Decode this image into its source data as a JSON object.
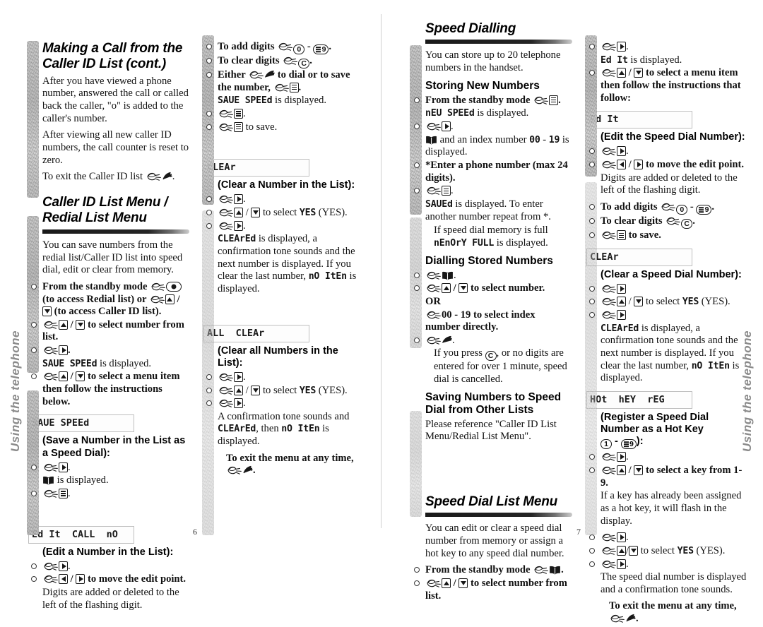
{
  "document": {
    "side_tab_label": "Using the telephone",
    "page_left_number": "6",
    "page_right_number": "7"
  },
  "page6": {
    "col1": {
      "heading": "Making a Call from the Caller ID List (cont.)",
      "para1": "After you have viewed a phone number, answered the call or called back the caller, \"o\" is added to the caller's number.",
      "para2": "After viewing all new caller ID numbers, the call counter is reset to zero.",
      "para3_pre": "To exit the Caller ID list ",
      "para3_post": ".",
      "section_heading": "Caller ID List Menu / Redial List Menu",
      "intro": "You can save numbers from the redial list/Caller ID list into speed dial, edit or clear from memory.",
      "step1_a": "From the standby mode ",
      "step1_b": " (to access Redial list) or ",
      "step1_c": " / ",
      "step1_d": " (to access Caller ID list).",
      "step2_a": "",
      "step2_b": " / ",
      "step2_c": " to select number from list.",
      "step3": ".",
      "line_saved_lcd": "SAUE SPEEd",
      "line_saved_post": " is displayed.",
      "step4_a": "",
      "step4_b": " / ",
      "step4_c": " to select a menu item then follow the instructions below.",
      "lcd_save_speed": "SAUE SPEEd",
      "sub_save": "(Save a Number in the List as a Speed Dial):",
      "save_step1": ".",
      "save_step2_post": " is displayed.",
      "save_step3": ".",
      "lcd_edit_call_no": "Ed It  CALL  nO",
      "sub_edit": "(Edit a Number in the List):",
      "edit_step1": ".",
      "edit_step2_mid": " / ",
      "edit_step2_post": " to  move the edit point.",
      "edit_note": "Digits are added or deleted to the left of the flashing digit."
    },
    "col2": {
      "add_digits_pre": "To add digits ",
      "add_digits_mid": " - ",
      "add_digits_post": ".",
      "clear_digits_pre": "To clear digits ",
      "clear_digits_post": ".",
      "either_pre": "Either ",
      "either_mid": " to dial or to save the number, ",
      "either_post": ".",
      "lcd_save_speed_inline": "SAUE SPEEd",
      "save_speed_post": " is displayed.",
      "step_menu": ".",
      "step_save_post": " to save.",
      "lcd_clear": "CLEAr",
      "sub_clear": "(Clear a Number in the List):",
      "clear_step1": ".",
      "clear_step2_mid": " / ",
      "clear_step2_post_a": " to select ",
      "clear_step2_yes": "YES",
      "clear_step2_post_b": " (YES).",
      "clear_step3": ".",
      "clear_result_lcd": "CLEArEd",
      "clear_result_a": " is displayed, a confirmation tone sounds and the next number is displayed. If you clear the last number, ",
      "clear_result_lcd2": "nO  ItEn",
      "clear_result_b": " is displayed.",
      "lcd_all_clear": "ALL  CLEAr",
      "sub_all_clear": "(Clear all Numbers in the List):",
      "allclear_result_a": "A confirmation tone sounds and ",
      "allclear_lcd1": "CLEArEd",
      "allclear_result_b": ", then ",
      "allclear_lcd2": "nO  ItEn",
      "allclear_result_c": " is displayed.",
      "exit_text": "To exit the menu at any time,",
      "exit_post": "."
    }
  },
  "page7": {
    "col1": {
      "section_heading": "Speed Dialling",
      "intro": "You can store up to 20 telephone numbers in the handset.",
      "sub_storing": "Storing New Numbers",
      "store_step1_pre": "From the standby mode ",
      "store_step1_post": ".",
      "lcd_new_speed": "nEU SPEEd",
      "new_speed_post": " is displayed.",
      "store_step2": ".",
      "store_step3_a": " and an index number ",
      "store_step3_lcd1": "00",
      "store_step3_b": " - ",
      "store_step3_lcd2": "19",
      "store_step3_c": " is displayed.",
      "store_step4": "*Enter a phone number (max 24 digits).",
      "store_step5": ".",
      "saved_lcd": "SAUEd",
      "saved_post": " is displayed. To enter another number repeat from *.",
      "memfull_a": "If speed dial memory is full ",
      "memfull_lcd": "nEnOrY FULL",
      "memfull_b": " is displayed.",
      "sub_dialling": "Dialling Stored Numbers",
      "dial_step1": ".",
      "dial_step2_mid": " / ",
      "dial_step2_post": " to select number.",
      "dial_or": "OR",
      "dial_step3": "00 - 19 to select index number directly.",
      "dial_step4": ".",
      "dial_note_a": "If you press ",
      "dial_note_b": ", or no digits are entered for over 1 minute, speed dial is cancelled.",
      "sub_saving_other": "Saving Numbers to Speed Dial from Other Lists",
      "saving_other_text": "Please reference \"Caller ID List Menu/Redial List Menu\".",
      "section_heading2": "Speed Dial List Menu",
      "intro2": "You can edit or clear a speed dial number from memory or assign a hot key to any speed dial number.",
      "sdl_step1_pre": "From the standby mode ",
      "sdl_step1_post": ".",
      "sdl_step2_mid": " / ",
      "sdl_step2_post": " to select number from list."
    },
    "col2": {
      "step1": ".",
      "edit_lcd_inline": "Ed It",
      "edit_inline_post": " is displayed.",
      "step2_mid": " / ",
      "step2_post": " to select a menu item then follow the instructions that follow:",
      "lcd_edit": "Ed It",
      "sub_edit": "(Edit the Speed Dial Number):",
      "edit_step1": ".",
      "edit_step2_mid": " / ",
      "edit_step2_post": " to move the edit point.",
      "edit_note": "Digits are added or deleted to the left of the flashing digit.",
      "add_digits_pre": "To add digits ",
      "add_digits_mid": " - ",
      "add_digits_post": ".",
      "clear_digits_pre": "To clear digits ",
      "clear_digits_post": ".",
      "save_post": " to save.",
      "lcd_clear": "CLEAr",
      "sub_clear": "(Clear a Speed Dial Number):",
      "clear_step1": "",
      "clear_step2_mid": " / ",
      "clear_step2_post_a": " to select ",
      "clear_step2_yes": "YES",
      "clear_step2_post_b": " (YES).",
      "clear_step3": "",
      "clear_result_lcd": "CLEArEd",
      "clear_result_a": " is displayed, a confirmation tone sounds and the next number is displayed. If you clear the last number, ",
      "clear_result_lcd2": "nO  ItEn",
      "clear_result_b": " is displayed.",
      "lcd_hot_key": "HOt  hEY  rEG",
      "sub_hotkey_line1": "(Register a Speed Dial Number as a Hot Key",
      "sub_hotkey_line2_pre": "",
      "sub_hotkey_line2_mid": " - ",
      "sub_hotkey_line2_post": "):",
      "hk_step1": ".",
      "hk_step2_mid": " / ",
      "hk_step2_post": " to select a key from 1-9.",
      "hk_note": "If a key has already been assigned as a hot key, it will flash in the display.",
      "hk_step3": ".",
      "hk_step4_mid": "/",
      "hk_step4_post_a": " to select ",
      "hk_step4_yes": "YES",
      "hk_step4_post_b": " (YES).",
      "hk_step5": ".",
      "hk_result": "The speed dial number is displayed and a confirmation tone sounds.",
      "exit_text": "To exit the menu at any time,",
      "exit_post": "."
    }
  },
  "icons": {
    "hand": "pointing-hand-icon",
    "key_menu": "menu-key-icon",
    "key_up": "up-arrow-key-icon",
    "key_down": "down-arrow-key-icon",
    "key_left": "left-arrow-key-icon",
    "key_right": "right-arrow-key-icon",
    "key_book": "phonebook-key-icon",
    "key_talk": "talk-key-icon",
    "key_end": "end-call-key-icon",
    "key_redial": "redial-key-icon",
    "key_0": "digit-0-key-icon",
    "key_1": "digit-1-key-icon",
    "key_9": "digit-9-key-icon",
    "key_c": "clear-key-icon"
  }
}
